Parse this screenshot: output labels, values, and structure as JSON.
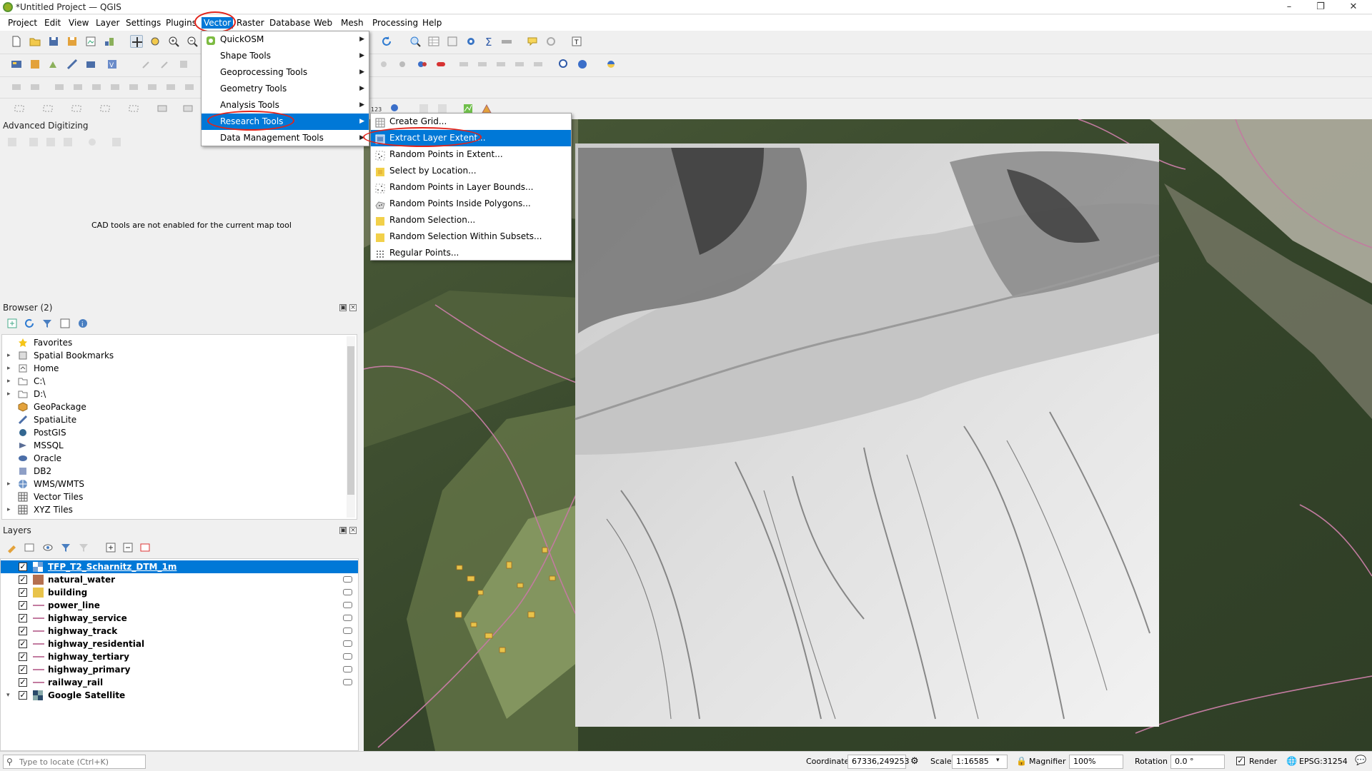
{
  "window": {
    "title": "*Untitled Project — QGIS"
  },
  "menubar": {
    "items": [
      "Project",
      "Edit",
      "View",
      "Layer",
      "Settings",
      "Plugins",
      "Vector",
      "Raster",
      "Database",
      "Web",
      "Mesh",
      "Processing",
      "Help"
    ],
    "active": "Vector"
  },
  "vector_menu": {
    "items": [
      {
        "label": "QuickOSM",
        "icon": "quickosm-icon",
        "submenu": true
      },
      {
        "label": "Shape Tools",
        "submenu": true
      },
      {
        "label": "Geoprocessing Tools",
        "submenu": true
      },
      {
        "label": "Geometry Tools",
        "submenu": true
      },
      {
        "label": "Analysis Tools",
        "submenu": true
      },
      {
        "label": "Research Tools",
        "submenu": true,
        "highlighted": true
      },
      {
        "label": "Data Management Tools",
        "submenu": true
      }
    ]
  },
  "research_menu": {
    "items": [
      {
        "label": "Create Grid...",
        "icon": "grid-icon"
      },
      {
        "label": "Extract Layer Extent...",
        "icon": "extent-icon",
        "highlighted": true
      },
      {
        "label": "Random Points in Extent...",
        "icon": "random-points-icon"
      },
      {
        "label": "Select by Location...",
        "icon": "select-location-icon"
      },
      {
        "label": "Random Points in Layer Bounds...",
        "icon": "random-points-icon"
      },
      {
        "label": "Random Points Inside Polygons...",
        "icon": "random-polygon-icon"
      },
      {
        "label": "Random Selection...",
        "icon": "random-selection-icon"
      },
      {
        "label": "Random Selection Within Subsets...",
        "icon": "random-selection-icon"
      },
      {
        "label": "Regular Points...",
        "icon": "regular-points-icon"
      }
    ]
  },
  "advanced_digitizing": {
    "title": "Advanced Digitizing",
    "message": "CAD tools are not enabled for the current map tool"
  },
  "browser": {
    "title": "Browser (2)",
    "items": [
      {
        "label": "Favorites",
        "icon": "star-icon",
        "expandable": false
      },
      {
        "label": "Spatial Bookmarks",
        "icon": "bookmark-icon",
        "expandable": true
      },
      {
        "label": "Home",
        "icon": "home-icon",
        "expandable": true
      },
      {
        "label": "C:\\",
        "icon": "folder-icon",
        "expandable": true
      },
      {
        "label": "D:\\",
        "icon": "folder-icon",
        "expandable": true
      },
      {
        "label": "GeoPackage",
        "icon": "geopackage-icon",
        "expandable": false
      },
      {
        "label": "SpatiaLite",
        "icon": "spatialite-icon",
        "expandable": false
      },
      {
        "label": "PostGIS",
        "icon": "postgis-icon",
        "expandable": false
      },
      {
        "label": "MSSQL",
        "icon": "mssql-icon",
        "expandable": false
      },
      {
        "label": "Oracle",
        "icon": "oracle-icon",
        "expandable": false
      },
      {
        "label": "DB2",
        "icon": "db2-icon",
        "expandable": false
      },
      {
        "label": "WMS/WMTS",
        "icon": "wms-icon",
        "expandable": true
      },
      {
        "label": "Vector Tiles",
        "icon": "vector-tiles-icon",
        "expandable": false
      },
      {
        "label": "XYZ Tiles",
        "icon": "xyz-tiles-icon",
        "expandable": true
      }
    ]
  },
  "layers": {
    "title": "Layers",
    "items": [
      {
        "name": "TFP_T2_Scharnitz_DTM_1m",
        "type": "raster",
        "checked": true,
        "selected": true
      },
      {
        "name": "natural_water",
        "type": "polygon",
        "color": "#b5704f",
        "checked": true
      },
      {
        "name": "building",
        "type": "polygon",
        "color": "#e8c34a",
        "checked": true
      },
      {
        "name": "power_line",
        "type": "line",
        "color": "#c27ba0",
        "checked": true
      },
      {
        "name": "highway_service",
        "type": "line",
        "color": "#c27ba0",
        "checked": true
      },
      {
        "name": "highway_track",
        "type": "line",
        "color": "#c27ba0",
        "checked": true
      },
      {
        "name": "highway_residential",
        "type": "line",
        "color": "#c27ba0",
        "checked": true
      },
      {
        "name": "highway_tertiary",
        "type": "line",
        "color": "#c27ba0",
        "checked": true
      },
      {
        "name": "highway_primary",
        "type": "line",
        "color": "#c27ba0",
        "checked": true
      },
      {
        "name": "railway_rail",
        "type": "line",
        "color": "#c27ba0",
        "checked": true
      },
      {
        "name": "Google Satellite",
        "type": "xyz",
        "checked": true
      }
    ]
  },
  "statusbar": {
    "locator_placeholder": "Type to locate (Ctrl+K)",
    "coordinate_label": "Coordinate",
    "coordinate_value": "67336,249253",
    "scale_label": "Scale",
    "scale_value": "1:16585",
    "magnifier_label": "Magnifier",
    "magnifier_value": "100%",
    "rotation_label": "Rotation",
    "rotation_value": "0.0 °",
    "render_label": "Render",
    "crs": "EPSG:31254"
  },
  "colors": {
    "selection": "#0078d7",
    "highlight_ring": "#e2231a",
    "osm_lines": "#c27ba0"
  }
}
